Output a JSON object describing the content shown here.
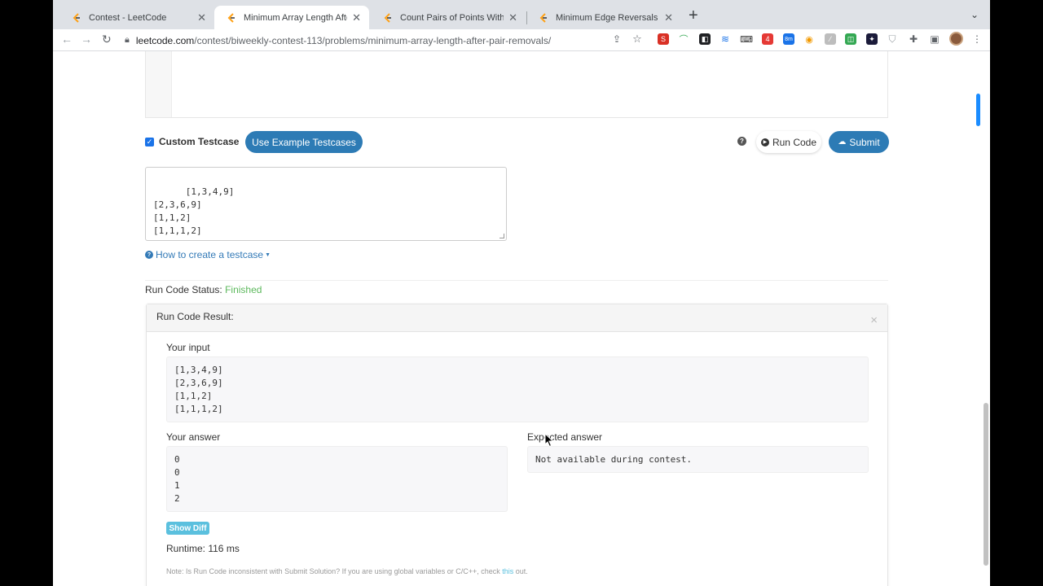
{
  "tabs": [
    {
      "title": "Contest - LeetCode",
      "active": false
    },
    {
      "title": "Minimum Array Length After Pa",
      "active": true
    },
    {
      "title": "Count Pairs of Points With Dis",
      "active": false
    },
    {
      "title": "Minimum Edge Reversals So Ev",
      "active": false
    }
  ],
  "address": {
    "host": "leetcode.com",
    "path": "/contest/biweekly-contest-113/problems/minimum-array-length-after-pair-removals/"
  },
  "extension_badges": {
    "first": "S",
    "second": "4",
    "third": "8m"
  },
  "testcase": {
    "custom_label": "Custom Testcase",
    "custom_checked": true,
    "example_button": "Use Example Testcases",
    "run_button": "Run Code",
    "submit_button": "Submit",
    "input_text": "[1,3,4,9]\n[2,3,6,9]\n[1,1,2]\n[1,1,1,2]",
    "howto_link": "How to create a testcase"
  },
  "status": {
    "label": "Run Code Status:",
    "value": "Finished",
    "color": "#5cb85c"
  },
  "result": {
    "title": "Run Code Result:",
    "your_input_label": "Your input",
    "your_input": "[1,3,4,9]\n[2,3,6,9]\n[1,1,2]\n[1,1,1,2]",
    "your_answer_label": "Your answer",
    "your_answer": "0\n0\n1\n2",
    "expected_label": "Expected answer",
    "expected": "Not available during contest.",
    "show_diff": "Show Diff",
    "runtime": "Runtime: 116 ms",
    "note_prefix": "Note: Is Run Code inconsistent with Submit Solution? If you are using global variables or C/C++, check ",
    "note_link": "this",
    "note_suffix": " out."
  },
  "colors": {
    "accent": "#2d7bb5",
    "info": "#5bc0de",
    "link": "#337ab7"
  }
}
